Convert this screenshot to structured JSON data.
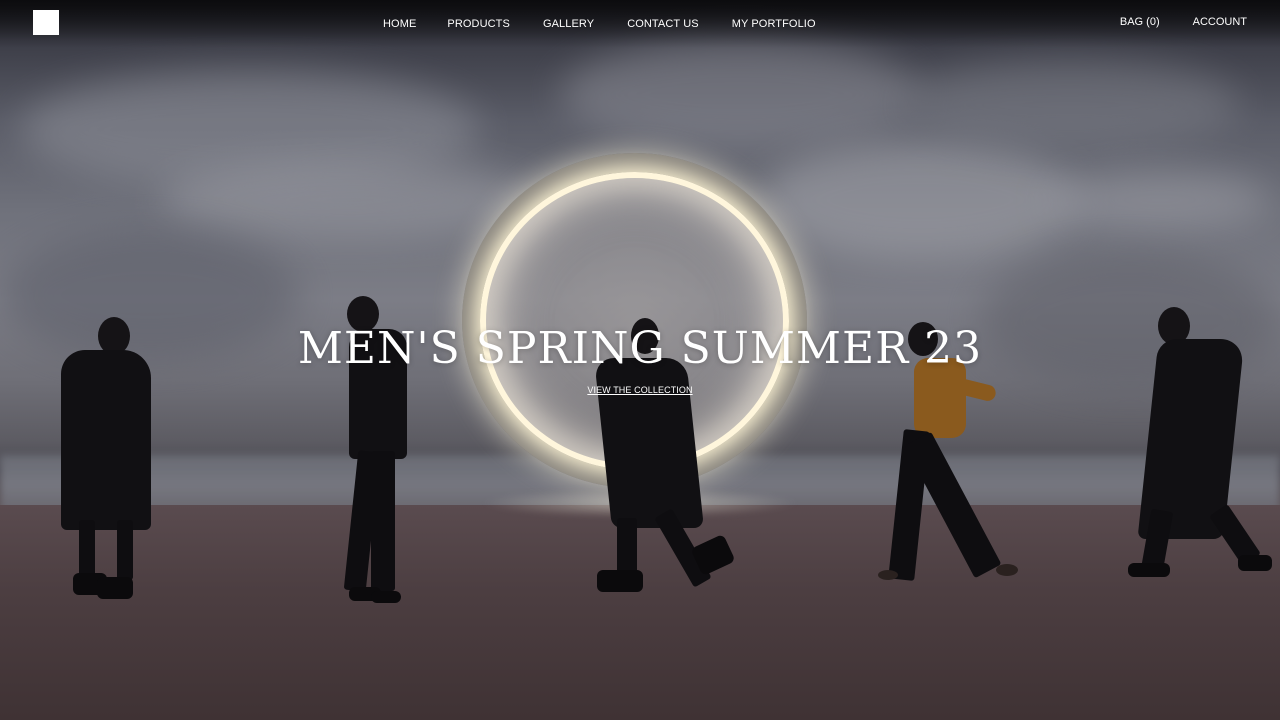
{
  "nav": {
    "items": [
      {
        "label": "HOME"
      },
      {
        "label": "PRODUCTS"
      },
      {
        "label": "GALLERY"
      },
      {
        "label": "CONTACT US"
      },
      {
        "label": "MY PORTFOLIO"
      }
    ]
  },
  "utility": {
    "bag_label": "BAG (0)",
    "account_label": "ACCOUNT"
  },
  "hero": {
    "headline": "MEN'S SPRING SUMMER 23",
    "cta_label": "VIEW THE COLLECTION"
  },
  "colors": {
    "text": "#ffffff",
    "logo": "#ffffff"
  }
}
